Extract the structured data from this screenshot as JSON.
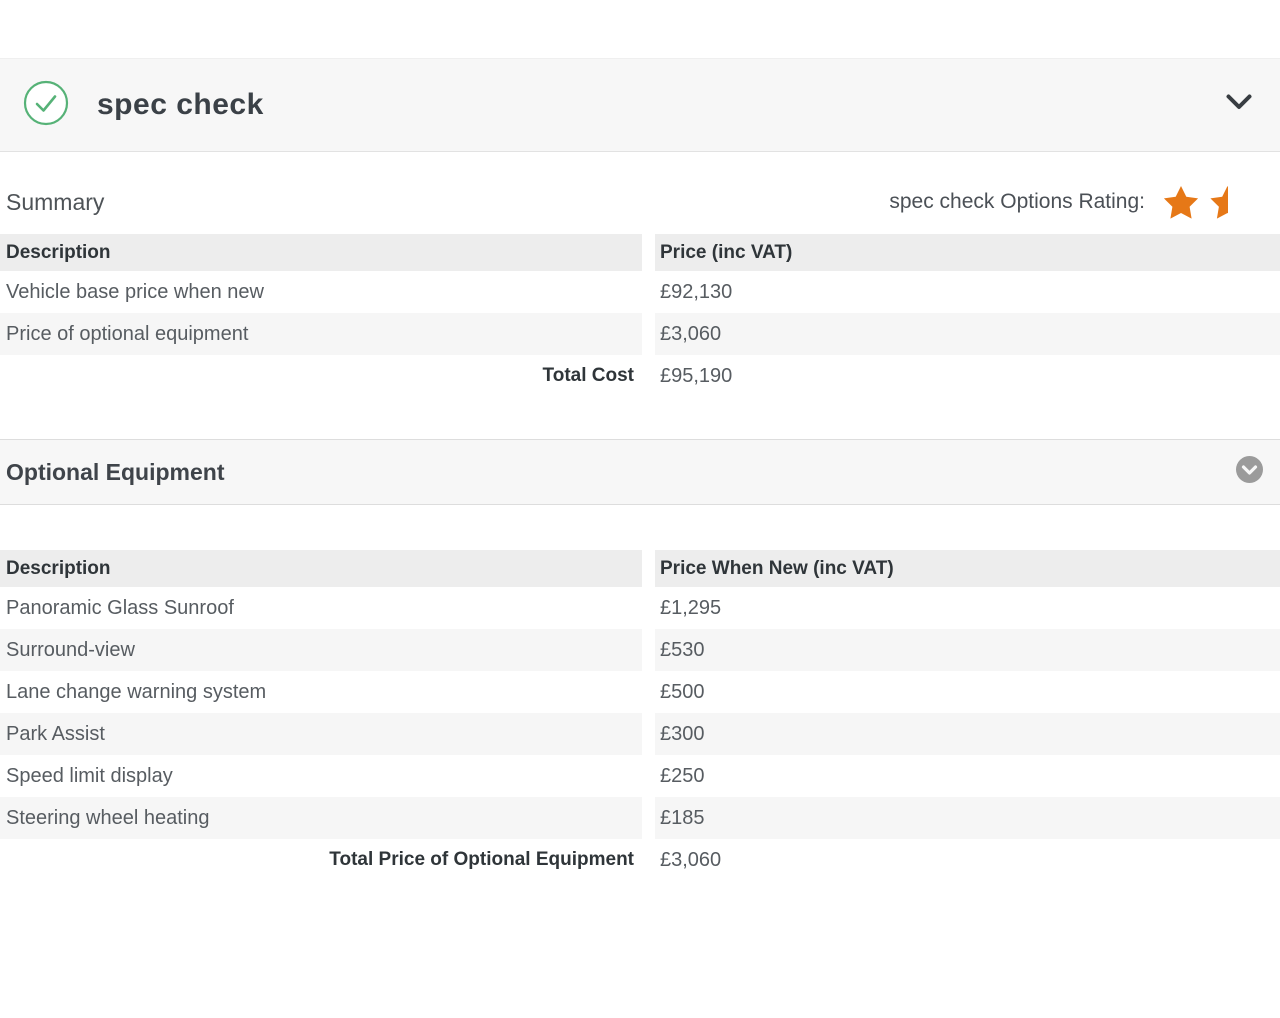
{
  "header": {
    "title": "spec check"
  },
  "summary": {
    "heading": "Summary",
    "rating": {
      "label": "spec check Options Rating:",
      "stars": 1.5
    },
    "table": {
      "columns": [
        "Description",
        "Price (inc VAT)"
      ],
      "rows": [
        {
          "description": "Vehicle base price when new",
          "price": "£92,130"
        },
        {
          "description": "Price of optional equipment",
          "price": "£3,060"
        }
      ],
      "total_label": "Total Cost",
      "total_value": "£95,190"
    }
  },
  "optional_equipment": {
    "heading": "Optional Equipment",
    "table": {
      "columns": [
        "Description",
        "Price When New (inc VAT)"
      ],
      "rows": [
        {
          "description": "Panoramic Glass Sunroof",
          "price": "£1,295"
        },
        {
          "description": "Surround-view",
          "price": "£530"
        },
        {
          "description": "Lane change warning system",
          "price": "£500"
        },
        {
          "description": "Park Assist",
          "price": "£300"
        },
        {
          "description": "Speed limit display",
          "price": "£250"
        },
        {
          "description": "Steering wheel heating",
          "price": "£185"
        }
      ],
      "total_label": "Total Price of Optional Equipment",
      "total_value": "£3,060"
    }
  },
  "colors": {
    "star_orange": "#e67817",
    "check_green": "#56b277",
    "circle_gray": "#9b9b9b",
    "chevron_dark": "#383d42"
  }
}
